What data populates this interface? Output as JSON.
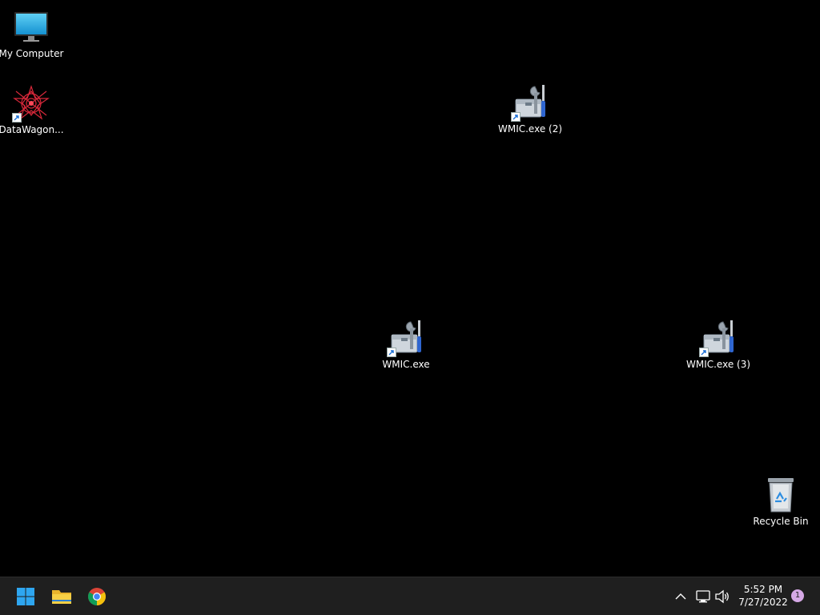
{
  "desktop": {
    "icons": [
      {
        "label": "My Computer",
        "icon": "monitor-icon"
      },
      {
        "label": "DataWagon...",
        "icon": "datawagon-icon",
        "shortcut": true
      },
      {
        "label": "WMIC.exe (2)",
        "icon": "toolbox-icon",
        "shortcut": true
      },
      {
        "label": "WMIC.exe",
        "icon": "toolbox-icon",
        "shortcut": true
      },
      {
        "label": "WMIC.exe (3)",
        "icon": "toolbox-icon",
        "shortcut": true
      },
      {
        "label": "Recycle Bin",
        "icon": "recycle-bin-icon"
      }
    ]
  },
  "taskbar": {
    "pinned": [
      {
        "icon": "windows-start-icon"
      },
      {
        "icon": "file-explorer-icon"
      },
      {
        "icon": "chrome-icon"
      }
    ],
    "tray": {
      "icons": [
        "chevron-up-icon",
        "network-icon",
        "volume-icon"
      ],
      "time": "5:52 PM",
      "date": "7/27/2022",
      "notification_count": "1"
    }
  },
  "colors": {
    "desktop_bg": "#000000",
    "taskbar_bg": "#1f1f1f",
    "badge": "#d6a9e6"
  }
}
